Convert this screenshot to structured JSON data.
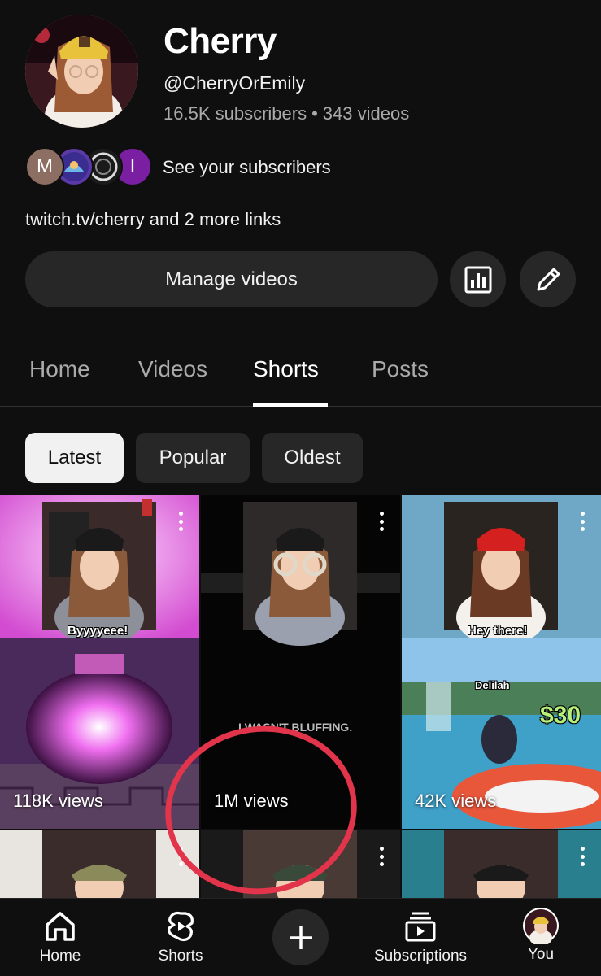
{
  "channel": {
    "name": "Cherry",
    "handle": "@CherryOrEmily",
    "subscribers": "16.5K subscribers",
    "separator": "•",
    "videos": "343 videos",
    "see_subscribers": "See your subscribers",
    "links": "twitch.tv/cherry and 2 more links",
    "subscriber_avatars": [
      "M",
      "",
      "",
      "I"
    ]
  },
  "actions": {
    "manage_videos": "Manage videos",
    "analytics_icon": "analytics-bar-chart-icon",
    "edit_icon": "pencil-edit-icon"
  },
  "tabs": [
    {
      "label": "Home",
      "active": false
    },
    {
      "label": "Videos",
      "active": false
    },
    {
      "label": "Shorts",
      "active": true
    },
    {
      "label": "Posts",
      "active": false
    }
  ],
  "filters": [
    {
      "label": "Latest",
      "active": true
    },
    {
      "label": "Popular",
      "active": false
    },
    {
      "label": "Oldest",
      "active": false
    }
  ],
  "shorts": [
    {
      "views": "118K views",
      "caption": "Byyyyeee!"
    },
    {
      "views": "1M views",
      "caption": "I WASN'T BLUFFING."
    },
    {
      "views": "42K views",
      "caption": "Hey there!",
      "game_name": "Delilah",
      "game_amount": "$30"
    }
  ],
  "bottom_nav": [
    {
      "label": "Home",
      "icon": "home-icon"
    },
    {
      "label": "Shorts",
      "icon": "shorts-icon"
    },
    {
      "label": "",
      "icon": "plus-icon"
    },
    {
      "label": "Subscriptions",
      "icon": "subscriptions-icon"
    },
    {
      "label": "You",
      "icon": "avatar"
    }
  ],
  "colors": {
    "background": "#0f0f0f",
    "surface": "#272727",
    "annotation_circle": "#e2344b"
  }
}
